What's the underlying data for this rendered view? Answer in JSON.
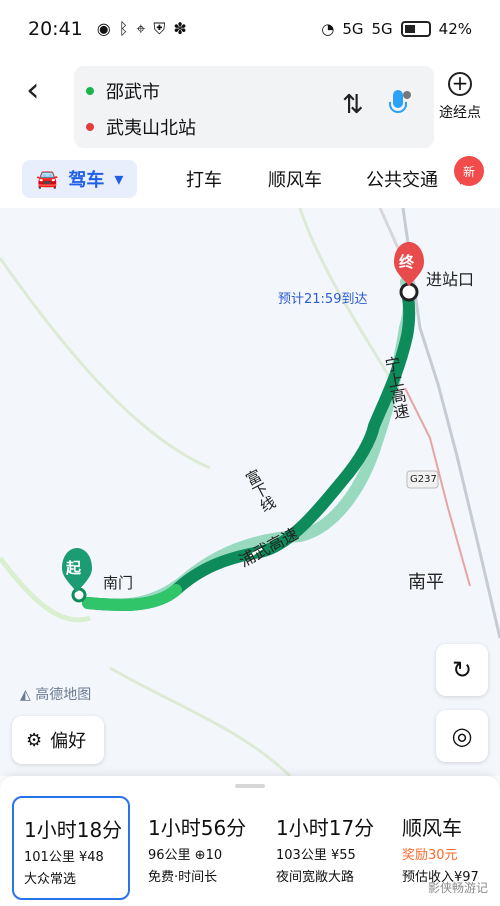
{
  "status": {
    "time": "20:41",
    "battery": "42%",
    "signal1": "5G",
    "signal2": "5G"
  },
  "route": {
    "start": "邵武市",
    "end": "武夷山北站",
    "add_label": "途经点"
  },
  "tabs": [
    "驾车",
    "打车",
    "顺风车",
    "公共交通"
  ],
  "tab_badge": "新",
  "map": {
    "eta": "预计21:59到达",
    "end_label": "终",
    "end_text": "进站口",
    "start_label": "起",
    "start_text": "南门",
    "road1": "宁上高速",
    "road2": "浦武高速",
    "road3": "富下线",
    "city": "南平",
    "road_code": "G237",
    "brand": "高德地图",
    "pref_label": "偏好"
  },
  "cards": [
    {
      "time": "1小时18分",
      "line1": "101公里 ¥48",
      "line2": "大众常选"
    },
    {
      "time": "1小时56分",
      "line1": "96公里 ⊕10",
      "line2": "免费·时间长"
    },
    {
      "time": "1小时17分",
      "line1": "103公里 ¥55",
      "line2": "夜间宽敞大路"
    },
    {
      "time": "顺风车",
      "line1": "奖励30元",
      "line2": "预估收入¥97"
    }
  ],
  "watermark": "影侠畅游记",
  "colors": {
    "primary": "#1f5ee6",
    "route_dark": "#0e8b5b",
    "route_light": "#98d9c0",
    "accent_orange": "#ff6a2b"
  }
}
